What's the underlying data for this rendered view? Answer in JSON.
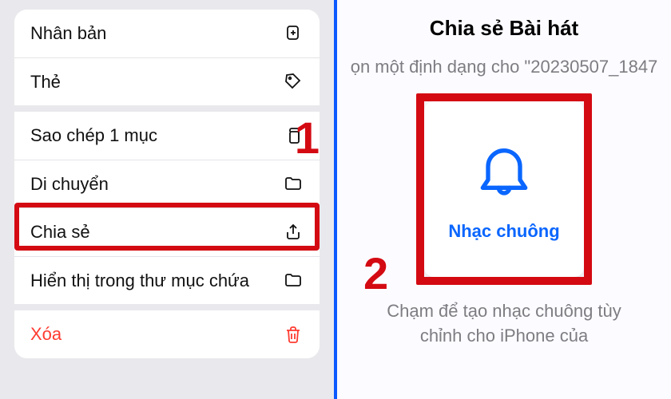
{
  "menu": {
    "duplicate": "Nhân bản",
    "tags": "Thẻ",
    "copy": "Sao chép 1 mục",
    "move": "Di chuyển",
    "share": "Chia sẻ",
    "showInFolder": "Hiển thị trong thư mục chứa",
    "delete": "Xóa"
  },
  "steps": {
    "one": "1",
    "two": "2"
  },
  "right": {
    "title": "Chia sẻ Bài hát",
    "subtitle": "ọn một định dạng cho \"20230507_1847",
    "ringtone": "Nhạc chuông",
    "hint": "Chạm để tạo nhạc chuông tùy chỉnh cho iPhone của"
  }
}
